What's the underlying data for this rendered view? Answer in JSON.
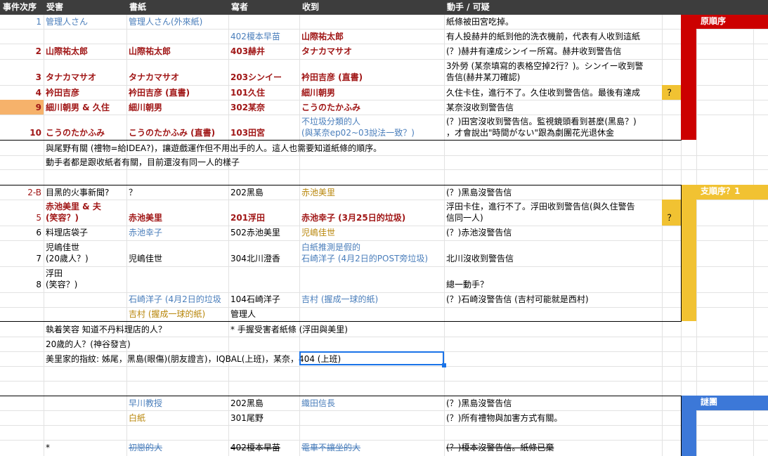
{
  "headers": {
    "order": "事件次序",
    "victim": "受害",
    "letter": "書紙",
    "sender": "寫者",
    "receiver": "收到",
    "note": "動手 / 可疑"
  },
  "sections": {
    "original": "原順序",
    "branch": "支順序？1",
    "mystery": "謎團"
  },
  "rows": {
    "r1": {
      "order": "1",
      "victim": "管理人さん",
      "letter": "管理人さん(外來紙)",
      "sender": "",
      "receiver": "",
      "note": "紙條被田宮吃掉。"
    },
    "r2": {
      "sender": "402榎本早苗",
      "receiver": "山際祐太郎",
      "note": "有人投赫井的紙到他的洗衣機前，代表有人收到這紙"
    },
    "r3": {
      "order": "2",
      "victim": "山際祐太郎",
      "letter": "山際祐太郎",
      "sender": "403赫井",
      "receiver": "タナカマサオ",
      "note": "(？)赫井有達成シンイー所寫。赫井收到警告信"
    },
    "r4": {
      "order": "3",
      "victim": "タナカマサオ",
      "letter": "タナカマサオ",
      "sender": "203シンイー",
      "receiver": "衿田吉彦 (直書)",
      "note1": "3外勞 (某奈填寫的表格空掉2行？)。シンイー收到警",
      "note2": "告信(赫井某刀確認)"
    },
    "r5": {
      "order": "4",
      "victim": "衿田吉彦",
      "letter": "衿田吉彦 (直書)",
      "sender": "101久住",
      "receiver": "細川朝男",
      "note": "久住卡住，進行不了。久住收到警告信。最後有達成",
      "flag": "？"
    },
    "r6": {
      "order": "9",
      "victim": "細川朝男 & 久住",
      "letter": "細川朝男",
      "sender": "302某奈",
      "receiver": "こうのたかふみ",
      "note": "某奈沒收到警告信"
    },
    "r7": {
      "order": "10",
      "victim": "こうのたかふみ",
      "letter": "こうのたかふみ (直書)",
      "sender": "103田宮",
      "receiver1": "不垃圾分類的人",
      "receiver2": "(與某奈ep02~03說法一致？)",
      "note1": "(？)田宮沒收到警告信。監視鏡頭看到甚麼(黑島？)",
      "note2": "，才會說出\"時間がない\"跟為劇團花光退休金"
    },
    "c1": "與尾野有關 (禮物=給IDEA?)，讓遊戲運作但不用出手的人。這人也需要知道紙條的順序。",
    "c2": "動手者都是跟收紙者有關，目前還沒有同一人的樣子",
    "b1": {
      "order": "2-B",
      "victim": "目黑的火事新聞?",
      "letter": "？",
      "sender": "202黑島",
      "receiver": "赤池美里",
      "note": "(？)黑島沒警告信"
    },
    "b2": {
      "order": "5",
      "victim1": "赤池美里 & 夫",
      "victim2": "(笑容？)",
      "letter": "赤池美里",
      "sender": "201浮田",
      "receiver": "赤池幸子 (3月25日的垃圾)",
      "note1": "浮田卡住，進行不了。浮田收到警告信(與久住警告",
      "note2": "信同一人)",
      "flag": "？"
    },
    "b3": {
      "order": "6",
      "victim": "料理店袋子",
      "letter": "赤池幸子",
      "sender": "502赤池美里",
      "receiver": "児嶋佳世",
      "note": "(？)赤池沒警告信"
    },
    "b4": {
      "order": "7",
      "victim1": "児嶋佳世",
      "victim2": "(20歲人？)",
      "letter": "児嶋佳世",
      "sender": "304北川澄香",
      "receiver1": "白紙推測是假的",
      "receiver2": "石崎洋子 (4月2日的POST旁垃圾)",
      "note": "北川沒收到警告信"
    },
    "b5": {
      "order": "8",
      "victim1": "浮田",
      "victim2": "(笑容？)",
      "note": "總一動手？"
    },
    "b6": {
      "letter": "石崎洋子 (4月2日的垃圾",
      "sender": "104石崎洋子",
      "receiver": "吉村 (握成一球的紙)",
      "note": "(？)石崎沒警告信 (吉村可能就是西村)"
    },
    "b7": {
      "letter": "吉村 (握成一球的紙)",
      "sender": "管理人"
    },
    "n1a": "執着笑容 知道不丹料理店的人？",
    "n1b": "* 手握受害者紙條 (浮田與美里)",
    "n2": "20歲的人？(神谷發言)",
    "n3": "美里家的指紋: 姊尾，黑島(眼傷)(朋友證言)，IQBAL(上班)，某奈，404 (上班)",
    "m1": {
      "letter": "早川教授",
      "sender": "202黑島",
      "receiver": "織田信長",
      "note": "(？)黑島沒警告信"
    },
    "m2": {
      "letter": "白紙",
      "sender": "301尾野",
      "note": "(？)所有禮物與加害方式有關。"
    },
    "m3": {
      "order": "*",
      "letter": "初戀的大",
      "sender": "402榎本早苗",
      "receiver": "電車不讓坐的大",
      "note": "(？)榎本沒警告信。紙條已棄"
    }
  },
  "colors": {
    "header_bg": "#3d3d3d",
    "original_red": "#cc0000",
    "branch_gold": "#f1c232",
    "mystery_blue": "#3c78d8",
    "highlight_orange": "#f6b26b",
    "selection_blue": "#1a73e8"
  }
}
